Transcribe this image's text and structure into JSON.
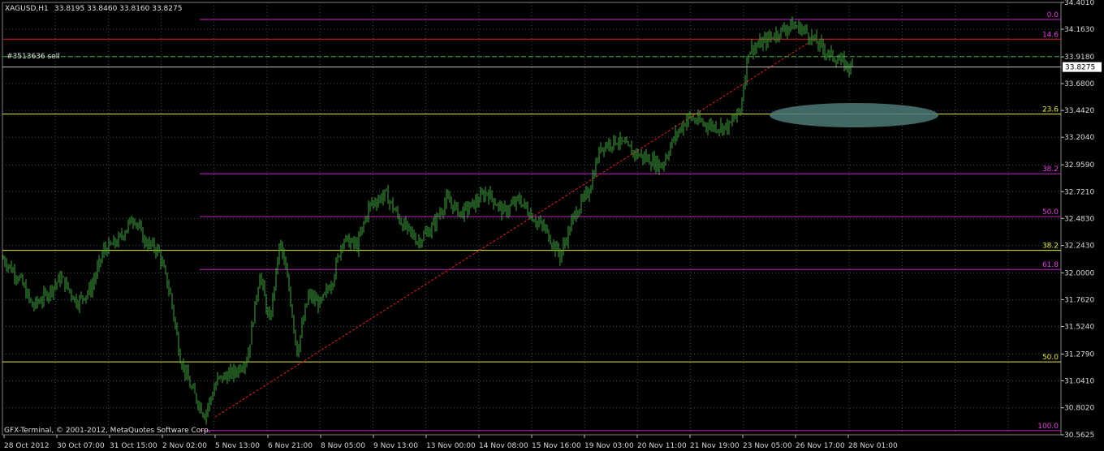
{
  "header": {
    "symbol": "XAGUSD,H1",
    "ohlc": "33.8195 33.8460 33.8160 33.8275"
  },
  "order_label": "#3513636 sell",
  "copyright": "GFX-Terminal, © 2001-2012, MetaQuotes Software Corp.",
  "current_price_label": "33.8275",
  "colors": {
    "background": "#000000",
    "candles": "#3fa33f",
    "grid": "#3a5060",
    "fib_magenta": "#c020c0",
    "fib_yellow": "#e8e840",
    "fib_red": "#e02020",
    "order_line": "#40b040",
    "trend_line": "#e02020",
    "ellipse": "#4d7a78",
    "fib_label": "#e040e0",
    "fib_label_yellow": "#e8e840",
    "current_price_line": "#c0c0c0"
  },
  "chart_data": {
    "type": "candlestick",
    "ylim": [
      30.5625,
      34.401
    ],
    "y_ticks": [
      "34.4010",
      "34.1630",
      "33.9180",
      "33.6800",
      "33.4420",
      "33.2040",
      "32.9590",
      "32.7210",
      "32.4830",
      "32.2430",
      "32.0000",
      "31.7620",
      "31.5240",
      "31.2790",
      "31.0410",
      "30.8020",
      "30.5625"
    ],
    "x_ticks": [
      "28 Oct 2012",
      "30 Oct 07:00",
      "31 Oct 15:00",
      "2 Nov 02:00",
      "5 Nov 13:00",
      "6 Nov 21:00",
      "8 Nov 05:00",
      "9 Nov 13:00",
      "13 Nov 00:00",
      "14 Nov 08:00",
      "15 Nov 16:00",
      "19 Nov 03:00",
      "20 Nov 11:00",
      "21 Nov 19:00",
      "23 Nov 05:00",
      "26 Nov 17:00",
      "28 Nov 01:00"
    ],
    "price_path": [
      [
        0,
        32.16
      ],
      [
        25,
        31.94
      ],
      [
        40,
        31.7
      ],
      [
        55,
        31.79
      ],
      [
        75,
        31.96
      ],
      [
        95,
        31.74
      ],
      [
        112,
        31.86
      ],
      [
        128,
        32.2
      ],
      [
        145,
        32.28
      ],
      [
        165,
        32.5
      ],
      [
        178,
        32.28
      ],
      [
        195,
        32.2
      ],
      [
        210,
        31.8
      ],
      [
        222,
        31.25
      ],
      [
        235,
        30.98
      ],
      [
        252,
        30.74
      ],
      [
        268,
        31.05
      ],
      [
        290,
        31.12
      ],
      [
        305,
        31.25
      ],
      [
        320,
        32.0
      ],
      [
        332,
        31.55
      ],
      [
        345,
        32.28
      ],
      [
        356,
        31.86
      ],
      [
        366,
        31.3
      ],
      [
        380,
        31.8
      ],
      [
        395,
        31.72
      ],
      [
        410,
        31.95
      ],
      [
        422,
        32.3
      ],
      [
        440,
        32.24
      ],
      [
        455,
        32.6
      ],
      [
        475,
        32.7
      ],
      [
        495,
        32.44
      ],
      [
        515,
        32.28
      ],
      [
        532,
        32.4
      ],
      [
        550,
        32.65
      ],
      [
        568,
        32.53
      ],
      [
        585,
        32.62
      ],
      [
        600,
        32.72
      ],
      [
        620,
        32.54
      ],
      [
        640,
        32.65
      ],
      [
        658,
        32.48
      ],
      [
        672,
        32.38
      ],
      [
        690,
        32.15
      ],
      [
        708,
        32.52
      ],
      [
        725,
        32.72
      ],
      [
        740,
        33.12
      ],
      [
        760,
        33.18
      ],
      [
        778,
        33.08
      ],
      [
        795,
        33.02
      ],
      [
        815,
        32.95
      ],
      [
        832,
        33.22
      ],
      [
        848,
        33.38
      ],
      [
        865,
        33.33
      ],
      [
        880,
        33.3
      ],
      [
        898,
        33.3
      ],
      [
        912,
        33.45
      ],
      [
        922,
        33.98
      ],
      [
        935,
        34.02
      ],
      [
        955,
        34.12
      ],
      [
        975,
        34.2
      ],
      [
        990,
        34.16
      ],
      [
        1005,
        34.05
      ],
      [
        1020,
        33.95
      ],
      [
        1035,
        33.88
      ],
      [
        1048,
        33.82
      ]
    ],
    "fib_levels": [
      {
        "label": "0.0",
        "value": 34.25,
        "color": "magenta"
      },
      {
        "label": "14.6",
        "value": 34.075,
        "color": "red"
      },
      {
        "label": "23.6",
        "value": 33.41,
        "color": "yellow"
      },
      {
        "label": "38.2",
        "value": 32.88,
        "color": "magenta"
      },
      {
        "label": "50.0",
        "value": 32.5,
        "color": "magenta"
      },
      {
        "label": "38.2",
        "value": 32.2,
        "color": "yellow"
      },
      {
        "label": "61.8",
        "value": 32.03,
        "color": "magenta"
      },
      {
        "label": "50.0",
        "value": 31.21,
        "color": "yellow"
      },
      {
        "label": "100.0",
        "value": 30.6,
        "color": "magenta"
      }
    ],
    "order_line_value": 33.92,
    "current_price": 33.8275,
    "trend_line": [
      [
        30.72,
        "5 Nov 13:00"
      ],
      [
        33.88,
        "23 Nov 05:00"
      ]
    ],
    "ellipse_center_value": 33.4
  }
}
